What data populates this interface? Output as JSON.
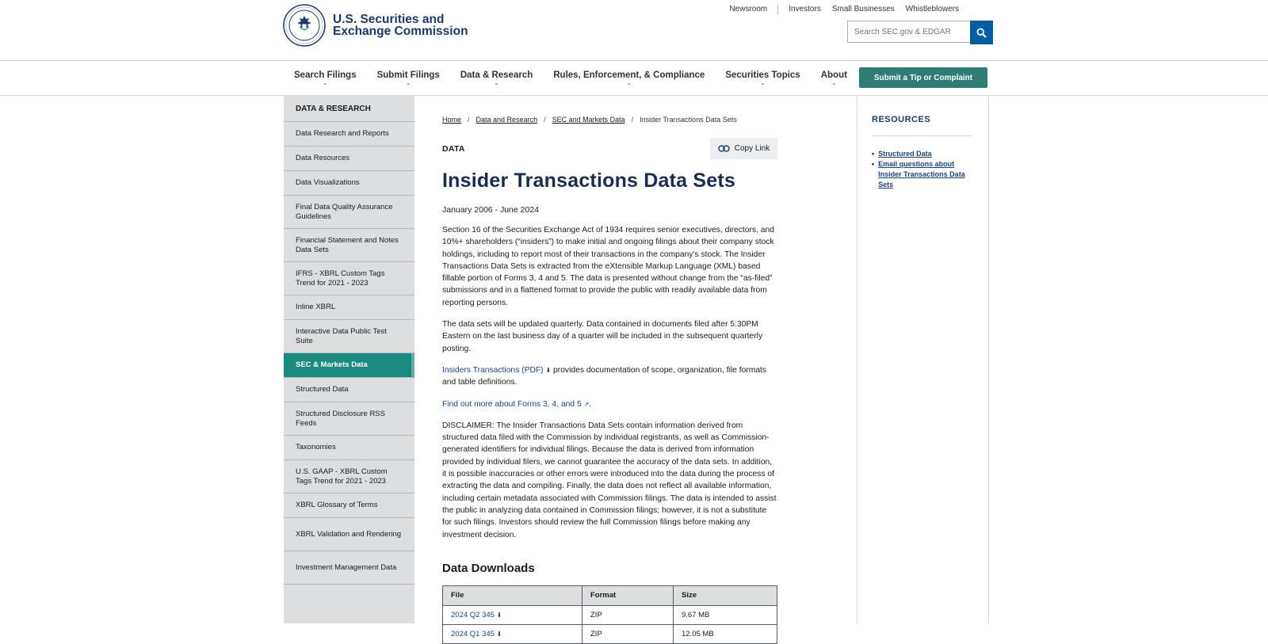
{
  "header": {
    "logo_line1": "U.S. Securities and",
    "logo_line2": "Exchange Commission",
    "utility_links": [
      "Newsroom",
      "Investors",
      "Small Businesses",
      "Whistleblowers"
    ],
    "search_placeholder": "Search SEC.gov & EDGAR"
  },
  "nav": {
    "items": [
      "Search Filings",
      "Submit Filings",
      "Data & Research",
      "Rules, Enforcement, & Compliance",
      "Securities Topics",
      "About"
    ],
    "tip_button": "Submit a Tip or Complaint"
  },
  "sidebar": {
    "header": "DATA & RESEARCH",
    "items": [
      {
        "label": "Data Research and Reports",
        "active": false
      },
      {
        "label": "Data Resources",
        "active": false
      },
      {
        "label": "Data Visualizations",
        "active": false
      },
      {
        "label": "Final Data Quality Assurance Guidelines",
        "active": false
      },
      {
        "label": "Financial Statement and Notes Data Sets",
        "active": false
      },
      {
        "label": "IFRS - XBRL Custom Tags Trend for 2021 - 2023",
        "active": false
      },
      {
        "label": "Inline XBRL",
        "active": false
      },
      {
        "label": "Interactive Data Public Test Suite",
        "active": false
      },
      {
        "label": "SEC & Markets Data",
        "active": true
      },
      {
        "label": "Structured Data",
        "active": false
      },
      {
        "label": "Structured Disclosure RSS Feeds",
        "active": false
      },
      {
        "label": "Taxonomies",
        "active": false
      },
      {
        "label": "U.S. GAAP - XBRL Custom Tags Trend for 2021 - 2023",
        "active": false
      },
      {
        "label": "XBRL Glossary of Terms",
        "active": false
      },
      {
        "label": "XBRL Validation and Rendering",
        "active": false
      },
      {
        "label": "Investment Management Data",
        "active": false
      }
    ]
  },
  "breadcrumb": {
    "home": "Home",
    "data_research": "Data and Research",
    "markets_data": "SEC and Markets Data",
    "current": "Insider Transactions Data Sets"
  },
  "main": {
    "label": "DATA",
    "copy_link": "Copy Link",
    "title": "Insider Transactions Data Sets",
    "date_range": "January 2006 - June 2024",
    "para1": "Section 16 of the Securities Exchange Act of 1934 requires senior executives, directors, and 10%+ shareholders (“insiders”) to make initial and ongoing filings about their company stock holdings, including to report most of their transactions in the company's stock. The Insider Transactions Data Sets is extracted from the eXtensible Markup Language (XML) based fillable portion of Forms 3, 4 and 5. The data is presented without change from the “as-filed” submissions and in a flattened format to provide the public with readily available data from reporting persons.",
    "para2": "The data sets will be updated quarterly. Data contained in documents filed after 5:30PM Eastern on the last business day of a quarter will be included in the subsequent quarterly posting.",
    "doc_link": "Insiders Transactions (PDF)",
    "doc_suffix": " provides documentation of scope, organization, file formats and table definitions.",
    "forms_link": "Find out more about Forms 3, 4, and 5",
    "disclaimer": "DISCLAIMER: The Insider Transactions Data Sets contain information derived from structured data filed with the Commission by individual registrants, as well as Commission-generated identifiers for individual filings. Because the data is derived from information provided by individual filers, we cannot guarantee the accuracy of the data sets. In addition, it is possible inaccuracies or other errors were introduced into the data during the process of extracting the data and compiling. Finally, the data does not reflect all available information, including certain metadata associated with Commission filings. The data is intended to assist the public in analyzing data contained in Commission filings; however, it is not a substitute for such filings. Investors should review the full Commission filings before making any investment decision.",
    "downloads_heading": "Data Downloads",
    "table_headers": [
      "File",
      "Format",
      "Size"
    ],
    "table_rows": [
      {
        "file": "2024 Q2 345",
        "format": "ZIP",
        "size": "9.67 MB"
      },
      {
        "file": "2024 Q1 345",
        "format": "ZIP",
        "size": "12.05 MB"
      }
    ]
  },
  "resources": {
    "title": "RESOURCES",
    "links": [
      "Structured Data",
      "Email questions about Insider Transactions Data Sets"
    ]
  },
  "colors": {
    "brand_navy": "#162e51",
    "search_blue": "#005ea2",
    "tip_green": "#2e7d75",
    "sidebar_active": "#1a8a80",
    "sidebar_bg": "#dcdee0"
  }
}
